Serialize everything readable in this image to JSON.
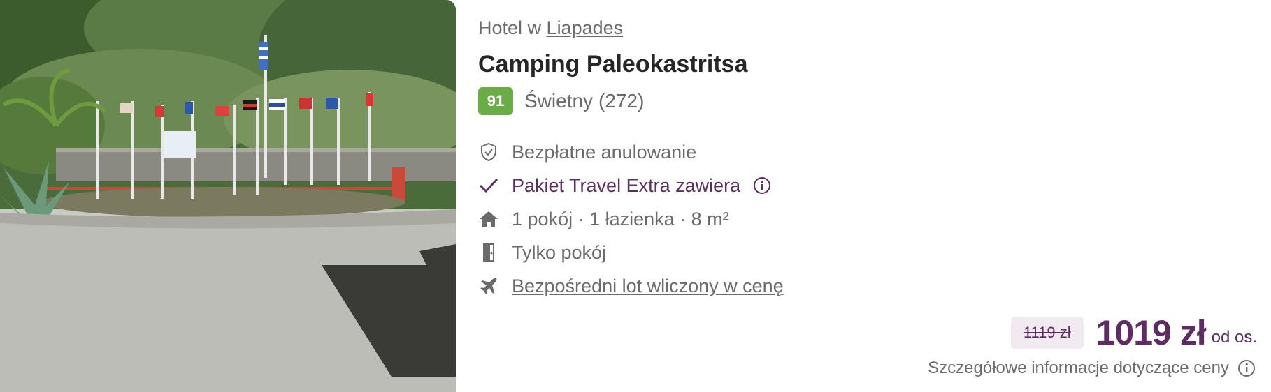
{
  "hotel": {
    "location_prefix": "Hotel w",
    "location_link": "Liapades",
    "name": "Camping Paleokastritsa",
    "score": "91",
    "rating_label": "Świetny",
    "rating_count": "(272)"
  },
  "features": [
    {
      "icon": "shield-check-icon",
      "text": "Bezpłatne anulowanie"
    },
    {
      "icon": "checkmark-icon",
      "text": "Pakiet Travel Extra zawiera",
      "has_info": true
    },
    {
      "icon": "house-icon",
      "text": "1 pokój · 1 łazienka · 8 m²"
    },
    {
      "icon": "door-icon",
      "text": "Tylko pokój"
    },
    {
      "icon": "airplane-icon",
      "text": "Bezpośredni lot wliczony w cenę"
    }
  ],
  "pricing": {
    "old_price": "1119 zł",
    "price": "1019 zł",
    "per_person": "od os.",
    "details_link": "Szczegółowe informacje dotyczące ceny"
  },
  "colors": {
    "brand_purple": "#5c2c63",
    "score_green": "#6aac46",
    "muted_text": "#6b6b6b"
  }
}
